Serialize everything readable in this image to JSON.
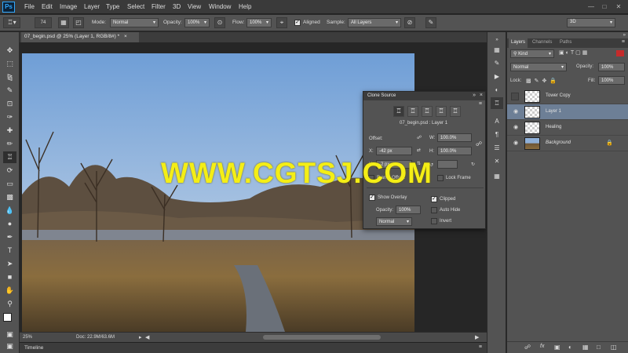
{
  "app": {
    "logo": "Ps",
    "menu": [
      "File",
      "Edit",
      "Image",
      "Layer",
      "Type",
      "Select",
      "Filter",
      "3D",
      "View",
      "Window",
      "Help"
    ],
    "window_controls": [
      "minimize-icon",
      "maximize-icon",
      "close-icon"
    ]
  },
  "options_bar": {
    "brush_size": "74",
    "mode_label": "Mode:",
    "mode_value": "Normal",
    "opacity_label": "Opacity:",
    "opacity_value": "100%",
    "flow_label": "Flow:",
    "flow_value": "100%",
    "aligned_label": "Aligned",
    "aligned_checked": true,
    "sample_label": "Sample:",
    "sample_value": "All Layers",
    "workspace_value": "3D"
  },
  "document": {
    "tab_title": "07_begin.psd @ 25% (Layer 1, RGB/8#) *",
    "zoom": "25%",
    "doc_size": "Doc: 22.9M/63.6M"
  },
  "timeline": {
    "label": "Timeline"
  },
  "layers_panel": {
    "tabs": [
      "Layers",
      "Channels",
      "Paths"
    ],
    "kind_value": "Kind",
    "blend_value": "Normal",
    "opacity_label": "Opacity:",
    "opacity_value": "100%",
    "lock_label": "Lock:",
    "fill_label": "Fill:",
    "fill_value": "100%",
    "layers": [
      {
        "name": "Tower Copy",
        "visible": false,
        "selected": false
      },
      {
        "name": "Layer 1",
        "visible": true,
        "selected": true
      },
      {
        "name": "Healing",
        "visible": true,
        "selected": false
      },
      {
        "name": "Background",
        "visible": true,
        "selected": false,
        "locked": true
      }
    ],
    "footer_icons": [
      "link-icon",
      "fx-icon",
      "mask-icon",
      "adjustment-icon",
      "group-icon",
      "new-layer-icon",
      "trash-icon"
    ]
  },
  "clone_source": {
    "title": "Clone Source",
    "source_name": "07_begin.psd : Layer 1",
    "offset_label": "Offset:",
    "x_label": "X:",
    "x_value": "-42 px",
    "y_label": "Y:",
    "y_value": "-2 px",
    "w_label": "W:",
    "w_value": "100.0%",
    "h_label": "H:",
    "h_value": "100.0%",
    "frame_offset_label": "Frame Offset:",
    "lock_frame_label": "Lock Frame",
    "show_overlay_label": "Show Overlay",
    "show_overlay_checked": true,
    "overlay_opacity_label": "Opacity:",
    "overlay_opacity_value": "100%",
    "overlay_mode_value": "Normal",
    "clipped_label": "Clipped",
    "clipped_checked": true,
    "auto_hide_label": "Auto Hide",
    "auto_hide_checked": false,
    "invert_label": "Invert",
    "invert_checked": false
  },
  "watermark": "WWW.CGTSJ.COM"
}
